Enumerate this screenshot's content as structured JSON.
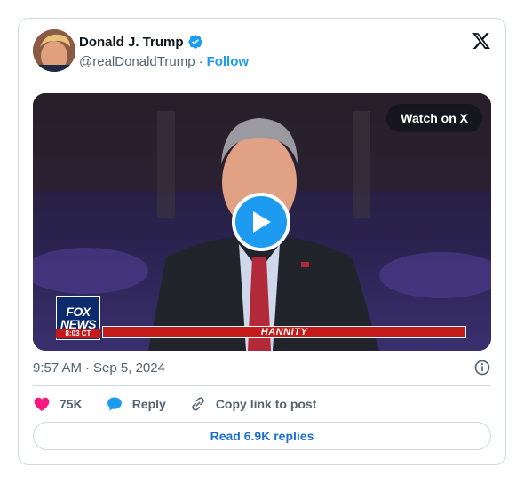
{
  "author": {
    "name": "Donald J. Trump",
    "handle": "@realDonaldTrump",
    "separator": "·",
    "follow_label": "Follow"
  },
  "media": {
    "watch_label": "Watch on X",
    "network_logo_top": "FOX",
    "network_logo_bottom": "NEWS",
    "clock": "8:03 CT",
    "show_banner": "HANNITY"
  },
  "meta": {
    "time": "9:57 AM",
    "separator": "·",
    "date": "Sep 5, 2024"
  },
  "actions": {
    "likes": "75K",
    "reply_label": "Reply",
    "copy_label": "Copy link to post"
  },
  "replies_button": "Read 6.9K replies",
  "colors": {
    "accent": "#1d9bf0",
    "like": "#f91880",
    "text": "#0f1419",
    "muted": "#536471",
    "border": "#cfd9de"
  },
  "icons": [
    "verified-badge-icon",
    "x-logo-icon",
    "play-icon",
    "info-icon",
    "heart-icon",
    "reply-bubble-icon",
    "link-icon"
  ]
}
